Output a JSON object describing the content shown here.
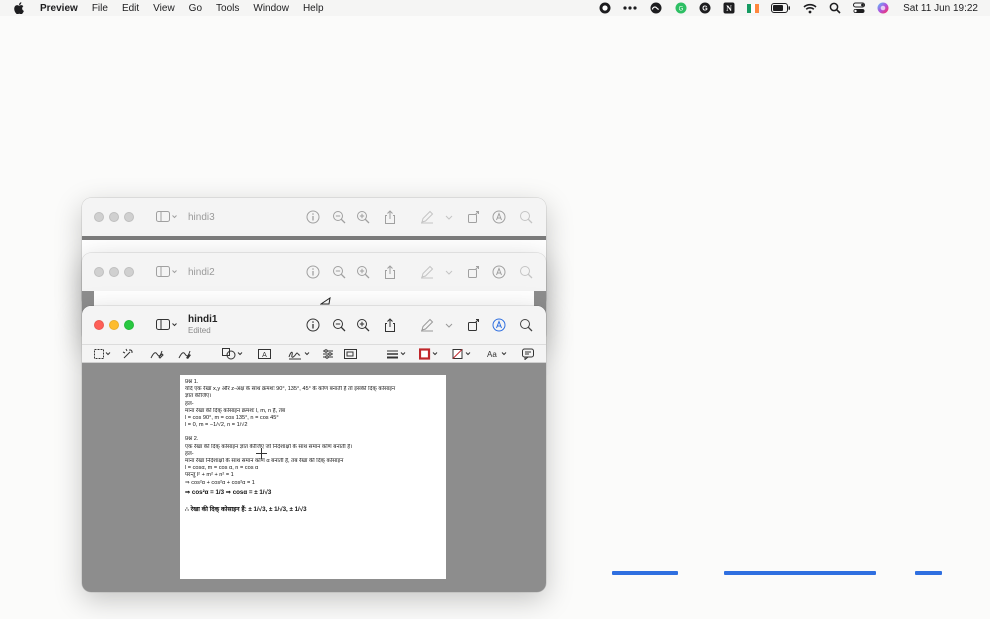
{
  "menubar": {
    "app_name": "Preview",
    "menus": [
      "File",
      "Edit",
      "View",
      "Go",
      "Tools",
      "Window",
      "Help"
    ],
    "status_icons": [
      "record-icon",
      "ellipsis-icon",
      "creative-cloud-icon",
      "grammarly-icon",
      "google-icon",
      "notion-icon",
      "flag-icon",
      "battery-icon",
      "wifi-icon",
      "search-icon",
      "control-center-icon",
      "siri-icon"
    ],
    "clock": "Sat 11 Jun  19:22"
  },
  "windows": {
    "back": {
      "title": "hindi3"
    },
    "middle": {
      "title": "hindi2"
    },
    "front": {
      "title": "hindi1",
      "subtitle": "Edited"
    }
  },
  "document": {
    "q1_heading": "प्रश्न 1.",
    "q1_line1": "यदि एक रेखा x,y और z-अक्ष के साथ क्रमशः 90°, 135°, 45° के कोण बनाती है तो इसकी दिक् कोसाइन",
    "q1_line2": "ज्ञात कीजिए।",
    "q1_sol": "हल-",
    "q1_line3": "माना रेखा की दिक् कोसाइन क्रमशः l, m, n हैं, तब",
    "q1_line4": "l = cos 90°, m = cos 135°, n = cos 45°",
    "q1_line5": "l = 0, m = −1/√2, n = 1/√2",
    "q2_heading": "प्रश्न 2.",
    "q2_line1": "एक रेखा की दिक् कोसाइन ज्ञात कीजिए जो निर्देशाक्षों के साथ समान कोण बनाती है।",
    "q2_sol": "हल-",
    "q2_line2": "माना रेखा निर्देशाक्षों के साथ समान कोण α बनाती है, तब रेखा की दिक् कोसाइन",
    "q2_line3": "l = cosα, m = cos α, n = cos α",
    "q2_line4": "परन्तु l² + m² + n² = 1",
    "q2_line5": "⇒ cos²α + cos²α + cos²α = 1",
    "q2_line6": "⇒  cos²α = 1/3  ⇒  cosα = ± 1/√3",
    "q2_line7": "∴  रेखा की दिक् कोसाइन हैं: ± 1/√3, ± 1/√3, ± 1/√3"
  },
  "colors": {
    "traffic_red": "#fe5f57",
    "traffic_yellow": "#febc2e",
    "traffic_green": "#28c840",
    "accent_blue": "#2f6fe0",
    "border_red": "#c0262b"
  }
}
